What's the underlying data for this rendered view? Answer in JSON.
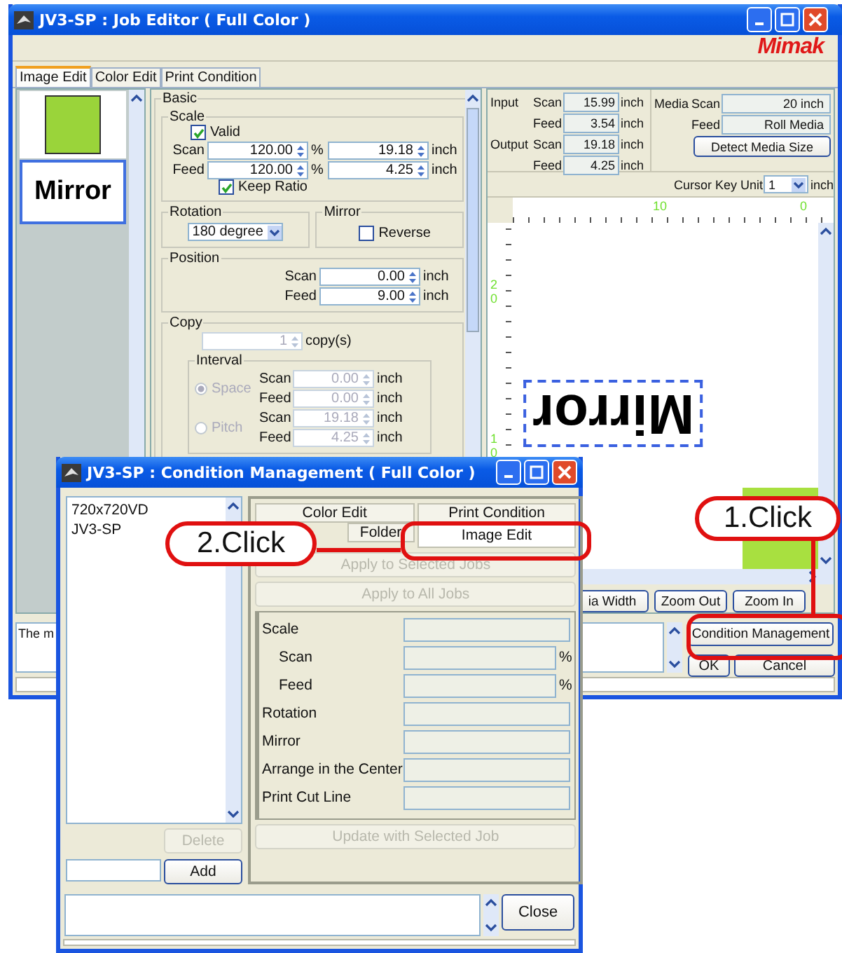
{
  "job_editor": {
    "title": "JV3-SP : Job Editor ( Full Color )",
    "logo": "Mimak",
    "tabs": [
      {
        "label": "Image Edit",
        "selected": true
      },
      {
        "label": "Color Edit",
        "selected": false
      },
      {
        "label": "Print Condition",
        "selected": false
      }
    ],
    "thumbnails": [
      {
        "kind": "photo",
        "selected": false
      },
      {
        "kind": "text",
        "label": "Mirror",
        "selected": true
      }
    ],
    "basic": {
      "title": "Basic",
      "scale": {
        "title": "Scale",
        "valid": {
          "label": "Valid",
          "checked": true
        },
        "rows": [
          {
            "label": "Scan",
            "percent": "120.00",
            "percent_unit": "%",
            "length": "19.18",
            "length_unit": "inch"
          },
          {
            "label": "Feed",
            "percent": "120.00",
            "percent_unit": "%",
            "length": "4.25",
            "length_unit": "inch"
          }
        ],
        "keep_ratio": {
          "label": "Keep Ratio",
          "checked": true
        }
      },
      "rotation": {
        "title": "Rotation",
        "value": "180 degree"
      },
      "mirror": {
        "title": "Mirror",
        "reverse": {
          "label": "Reverse",
          "checked": false
        }
      },
      "position": {
        "title": "Position",
        "rows": [
          {
            "label": "Scan",
            "value": "0.00",
            "unit": "inch"
          },
          {
            "label": "Feed",
            "value": "9.00",
            "unit": "inch"
          }
        ]
      },
      "copy": {
        "title": "Copy",
        "count": "1",
        "unit": "copy(s)",
        "disabled": true,
        "interval": {
          "title": "Interval",
          "options": [
            {
              "label": "Space",
              "selected": true,
              "rows": [
                {
                  "label": "Scan",
                  "value": "0.00",
                  "unit": "inch"
                },
                {
                  "label": "Feed",
                  "value": "0.00",
                  "unit": "inch"
                }
              ]
            },
            {
              "label": "Pitch",
              "selected": false,
              "rows": [
                {
                  "label": "Scan",
                  "value": "19.18",
                  "unit": "inch"
                },
                {
                  "label": "Feed",
                  "value": "4.25",
                  "unit": "inch"
                }
              ]
            }
          ]
        }
      }
    },
    "size_info": [
      {
        "group": "Input",
        "label": "Scan",
        "value": "15.99",
        "unit": "inch"
      },
      {
        "label": "Feed",
        "value": "3.54",
        "unit": "inch"
      },
      {
        "group": "Output",
        "label": "Scan",
        "value": "19.18",
        "unit": "inch"
      },
      {
        "label": "Feed",
        "value": "4.25",
        "unit": "inch"
      }
    ],
    "media": {
      "title": "Media",
      "rows": [
        {
          "label": "Scan",
          "value": "20 inch"
        },
        {
          "label": "Feed",
          "value": "Roll Media"
        }
      ],
      "button": "Detect Media Size"
    },
    "cursor_key_unit": {
      "label": "Cursor Key Unit",
      "value": "1",
      "unit": "inch"
    },
    "ruler": {
      "top_labels": [
        "10",
        "0"
      ],
      "left_labels": [
        "20",
        "10"
      ]
    },
    "canvas": {
      "text": "Mirror"
    },
    "view_buttons": [
      {
        "label": "ia Width"
      },
      {
        "label": "Zoom Out"
      },
      {
        "label": "Zoom In"
      }
    ],
    "message": "The m",
    "action_buttons": [
      {
        "label": "Condition Management"
      },
      {
        "label": "OK"
      },
      {
        "label": "Cancel"
      }
    ]
  },
  "condition_management": {
    "title": "JV3-SP : Condition Management ( Full Color )",
    "conditions": [
      {
        "label": "720x720VD"
      },
      {
        "label": "JV3-SP"
      }
    ],
    "delete": {
      "label": "Delete",
      "disabled": true
    },
    "add": {
      "label": "Add",
      "disabled": false
    },
    "tabs": [
      {
        "label": "Color Edit",
        "selected": false
      },
      {
        "label": "Print Condition",
        "selected": false
      },
      {
        "label": "Folder",
        "selected": false
      },
      {
        "label": "Image Edit",
        "selected": true
      }
    ],
    "apply_buttons": [
      {
        "label": "Apply to Selected Jobs",
        "disabled": true
      },
      {
        "label": "Apply to All Jobs",
        "disabled": true
      }
    ],
    "fields": [
      {
        "label": "Scale",
        "children": [
          {
            "label": "Scan",
            "unit": "%"
          },
          {
            "label": "Feed",
            "unit": "%"
          }
        ]
      },
      {
        "label": "Rotation"
      },
      {
        "label": "Mirror"
      },
      {
        "label": "Arrange in the Center"
      },
      {
        "label": "Print Cut Line"
      }
    ],
    "update": {
      "label": "Update with Selected Job",
      "disabled": true
    },
    "close": {
      "label": "Close",
      "disabled": false
    }
  },
  "callouts": [
    {
      "label": "1.Click"
    },
    {
      "label": "2.Click"
    }
  ]
}
